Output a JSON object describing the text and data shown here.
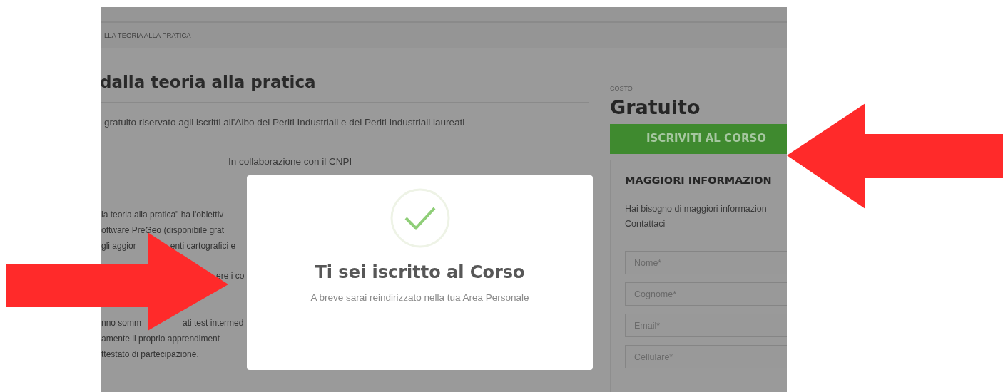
{
  "breadcrumb": "LLA TEORIA ALLA PRATICA",
  "course": {
    "title": "dalla teoria alla pratica",
    "subtitle": "gratuito riservato agli iscritti all'Albo dei Periti Industriali e dei Periti Industriali laureati",
    "collaboration": "In collaborazione con il CNPI",
    "paragraphs": [
      [
        [
          "la teoria alla pratica\" ha l'obiettiv"
        ],
        [
          "oftware PreGeo (disponibile grat"
        ],
        [
          "gli aggior",
          "enti cartografici e"
        ]
      ],
      [
        [
          "ere i co"
        ]
      ],
      [
        [
          "nno somm",
          "ati test intermed"
        ],
        [
          "amente il proprio apprendiment"
        ],
        [
          "ttestato di partecipazione."
        ]
      ]
    ]
  },
  "sidebar": {
    "price_label": "COSTO",
    "price": "Gratuito",
    "enroll_button": "ISCRIVITI AL CORSO",
    "info_title": "MAGGIORI INFORMAZION",
    "info_text": [
      "Hai bisogno di maggiori informazion",
      "Contattaci"
    ],
    "fields": [
      {
        "placeholder": "Nome*"
      },
      {
        "placeholder": "Cognome*"
      },
      {
        "placeholder": "Email*"
      },
      {
        "placeholder": "Cellulare*"
      }
    ]
  },
  "modal": {
    "title": "Ti sei iscritto al Corso",
    "message": "A breve sarai reindirizzato nella tua Area Personale"
  }
}
